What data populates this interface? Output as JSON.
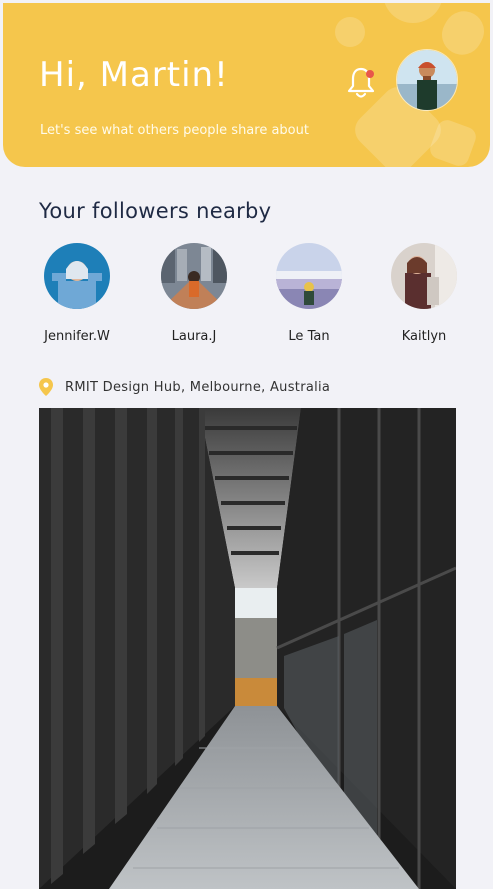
{
  "header": {
    "greeting": "Hi, Martin!",
    "subtitle": "Let's see what others people share about",
    "notification_icon": "bell-icon",
    "notification_dot_color": "#e8564a",
    "accent_color": "#f5c64c"
  },
  "followers": {
    "title": "Your followers nearby",
    "items": [
      {
        "name": "Jennifer.W"
      },
      {
        "name": "Laura.J"
      },
      {
        "name": "Le Tan"
      },
      {
        "name": "Kaitlyn"
      }
    ]
  },
  "post": {
    "location_icon": "location-pin-icon",
    "location": "RMIT Design Hub, Melbourne, Australia"
  }
}
